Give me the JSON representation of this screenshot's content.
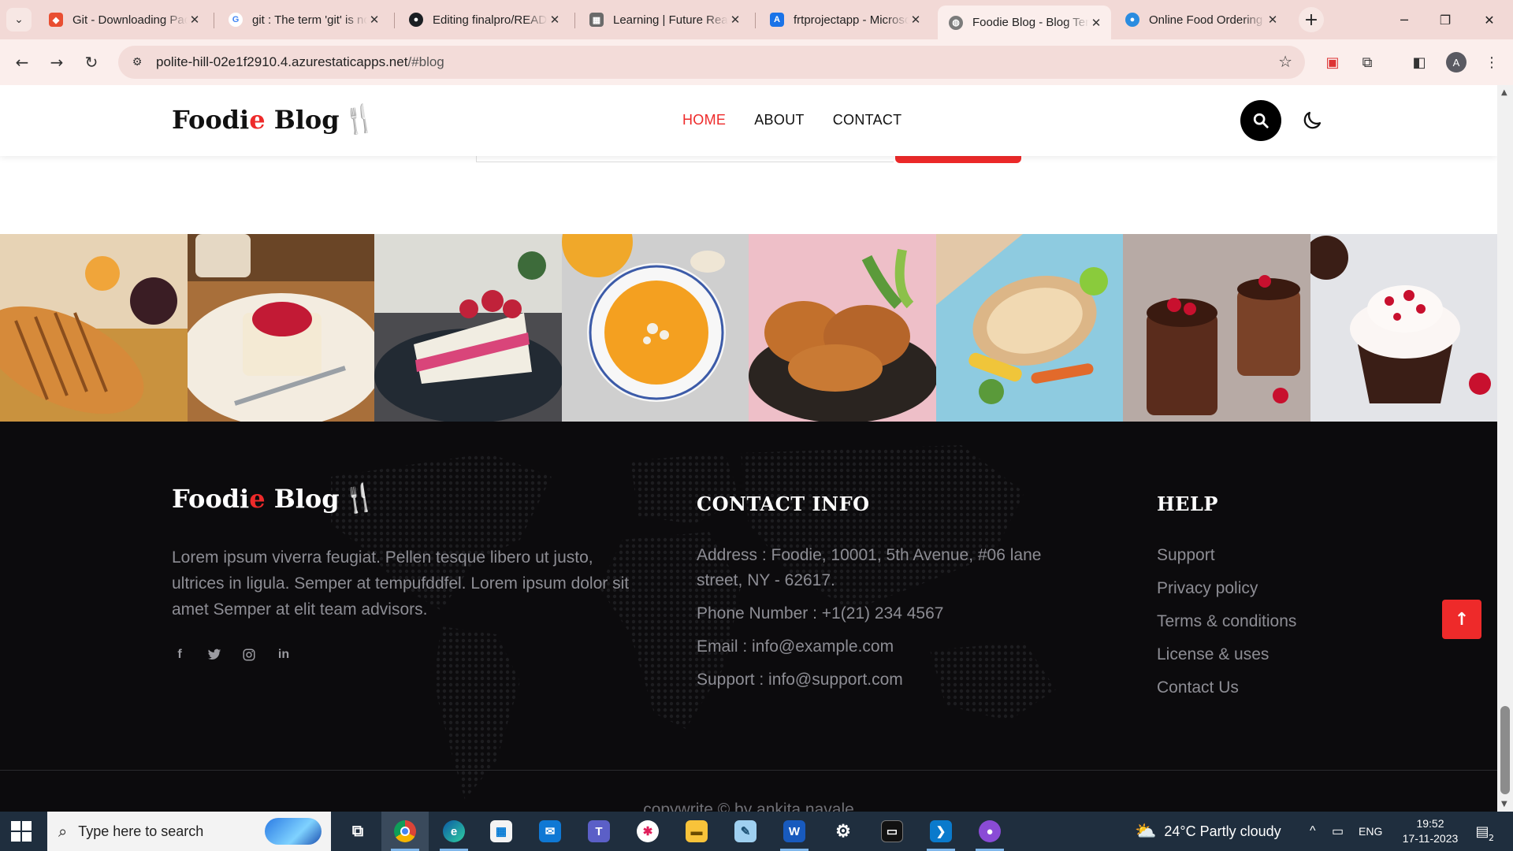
{
  "browser": {
    "tabs": [
      {
        "title": "Git - Downloading Package",
        "color": "#e94e31",
        "glyph": "◆",
        "icon": "git-icon"
      },
      {
        "title": "git : The term 'git' is not",
        "color": "#ffffff",
        "glyph": "G",
        "icon": "google-icon"
      },
      {
        "title": "Editing finalpro/README",
        "color": "#1b1f23",
        "glyph": "●",
        "icon": "github-icon"
      },
      {
        "title": "Learning | Future Ready",
        "color": "#6a6a6a",
        "glyph": "▦",
        "icon": "learning-icon"
      },
      {
        "title": "frtprojectapp - Microsoft",
        "color": "#1a73e8",
        "glyph": "A",
        "icon": "azure-icon"
      },
      {
        "title": "Foodie Blog - Blog Template",
        "color": "#7b7b7b",
        "glyph": "◍",
        "icon": "globe-icon"
      },
      {
        "title": "Online Food Ordering",
        "color": "#2a8ce0",
        "glyph": "●",
        "icon": "web-icon"
      }
    ],
    "active_tab_index": 5,
    "url_host": "polite-hill-02e1f2910.4.azurestaticapps.net",
    "url_path": "/#blog",
    "profile_initial": "A"
  },
  "site": {
    "logo": {
      "part1": "Foodi",
      "accent": "e",
      "part2": " Blog"
    },
    "nav": [
      {
        "label": "HOME",
        "active": true
      },
      {
        "label": "ABOUT",
        "active": false
      },
      {
        "label": "CONTACT",
        "active": false
      }
    ],
    "gallery": [
      {
        "name": "bread",
        "bg": "#c98a45"
      },
      {
        "name": "panna-cotta",
        "bg": "#e9dcc5"
      },
      {
        "name": "berry-cake",
        "bg": "#3c3a3e"
      },
      {
        "name": "pumpkin-soup",
        "bg": "#d2d2d2"
      },
      {
        "name": "fried-chicken",
        "bg": "#e7b6c0"
      },
      {
        "name": "fish-plate",
        "bg": "#8ec9df"
      },
      {
        "name": "chocolate-mousse",
        "bg": "#b8aca6"
      },
      {
        "name": "cupcake",
        "bg": "#e6e6ea"
      }
    ],
    "footer": {
      "about": "Lorem ipsum viverra feugiat. Pellen tesque libero ut justo, ultrices in ligula. Semper at tempufddfel. Lorem ipsum dolor sit amet Semper at elit team advisors.",
      "contact_heading": "CONTACT INFO",
      "contact": [
        "Address : Foodie, 10001, 5th Avenue, #06 lane street, NY - 62617.",
        "Phone Number : +1(21) 234 4567",
        "Email : info@example.com",
        "Support : info@support.com"
      ],
      "help_heading": "HELP",
      "help": [
        "Support",
        "Privacy policy",
        "Terms & conditions",
        "License & uses",
        "Contact Us"
      ],
      "copyright": "copywrite © by ankita navale"
    }
  },
  "taskbar": {
    "search_placeholder": "Type here to search",
    "weather": "24°C  Partly cloudy",
    "lang": "ENG",
    "time": "19:52",
    "date": "17-11-2023",
    "notification_count": "2"
  }
}
